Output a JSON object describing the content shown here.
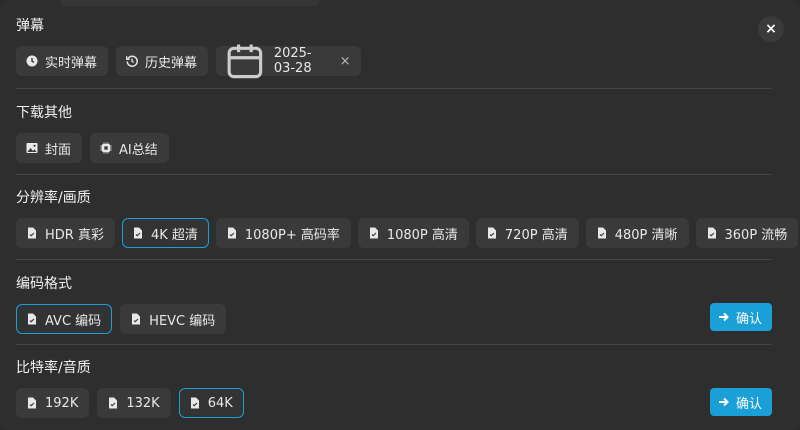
{
  "close_label": "×",
  "danmaku": {
    "title": "弹幕",
    "realtime": "实时弹幕",
    "history": "历史弹幕",
    "date": "2025-03-28",
    "clear": "×"
  },
  "download_other": {
    "title": "下载其他",
    "cover": "封面",
    "ai_summary": "AI总结"
  },
  "resolution": {
    "title": "分辨率/画质",
    "options": [
      "HDR 真彩",
      "4K 超清",
      "1080P+ 高码率",
      "1080P 高清",
      "720P 高清",
      "480P 清晰",
      "360P 流畅"
    ],
    "selected": "4K 超清"
  },
  "codec": {
    "title": "编码格式",
    "options": [
      "AVC 编码",
      "HEVC 编码"
    ],
    "selected": "AVC 编码",
    "confirm": "确认"
  },
  "bitrate": {
    "title": "比特率/音质",
    "options": [
      "192K",
      "132K",
      "64K"
    ],
    "selected": "64K",
    "confirm": "确认"
  },
  "colors": {
    "accent": "#1a9fd6",
    "panel": "#2e2e2e",
    "chip": "#3a3a3a"
  }
}
